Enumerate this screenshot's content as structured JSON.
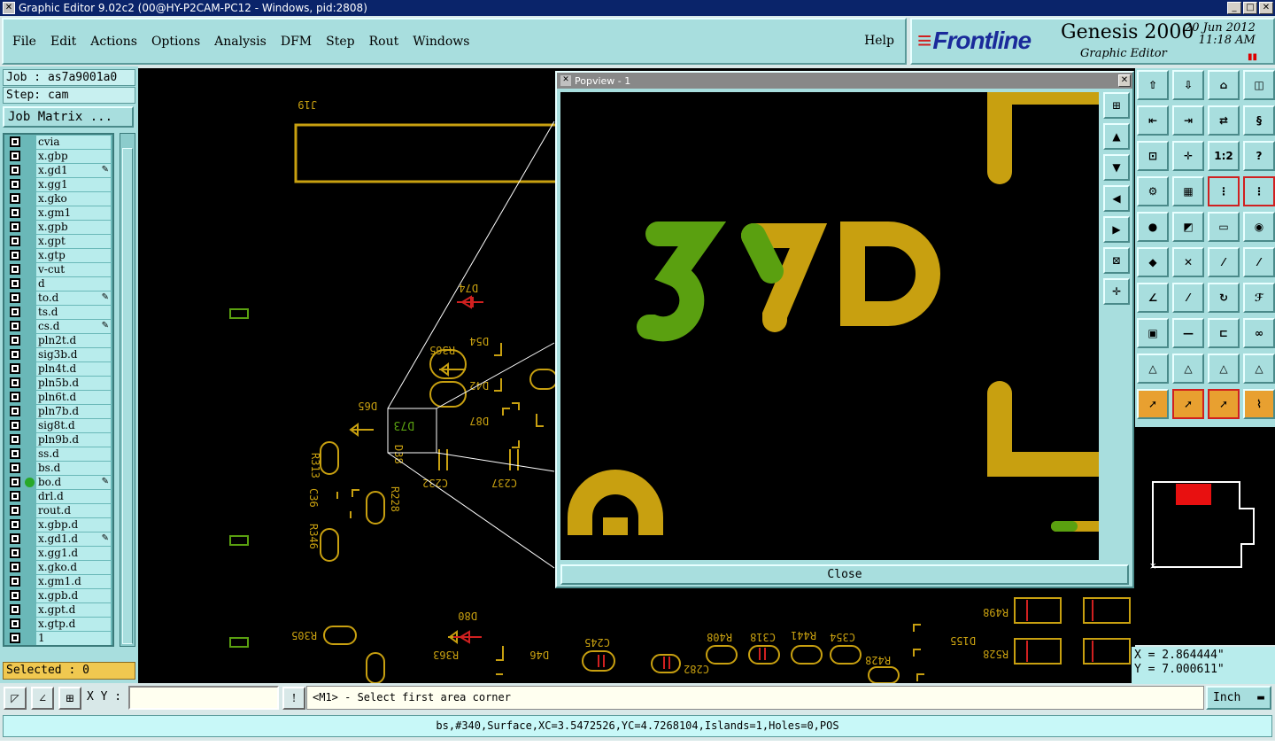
{
  "window": {
    "title": "Graphic Editor 9.02c2 (00@HY-P2CAM-PC12 - Windows, pid:2808)"
  },
  "menu": [
    "File",
    "Edit",
    "Actions",
    "Options",
    "Analysis",
    "DFM",
    "Step",
    "Rout",
    "Windows"
  ],
  "help_label": "Help",
  "brand": {
    "logo": "Frontline",
    "product": "Genesis 2000",
    "subtitle": "Graphic Editor",
    "date": "20 Jun 2012",
    "time": "11:18 AM"
  },
  "job": {
    "job_label": "Job : as7a9001a0",
    "step_label": "Step: cam",
    "matrix_button": "Job Matrix ..."
  },
  "layers": [
    {
      "name": "cvia"
    },
    {
      "name": "x.gbp"
    },
    {
      "name": "x.gd1",
      "mark": true
    },
    {
      "name": "x.gg1"
    },
    {
      "name": "x.gko"
    },
    {
      "name": "x.gm1"
    },
    {
      "name": "x.gpb"
    },
    {
      "name": "x.gpt"
    },
    {
      "name": "x.gtp"
    },
    {
      "name": "v-cut"
    },
    {
      "name": "d"
    },
    {
      "name": "to.d",
      "mark": true
    },
    {
      "name": "ts.d"
    },
    {
      "name": "cs.d",
      "mark": true
    },
    {
      "name": "pln2t.d"
    },
    {
      "name": "sig3b.d"
    },
    {
      "name": "pln4t.d"
    },
    {
      "name": "pln5b.d"
    },
    {
      "name": "pln6t.d"
    },
    {
      "name": "pln7b.d"
    },
    {
      "name": "sig8t.d"
    },
    {
      "name": "pln9b.d"
    },
    {
      "name": "ss.d"
    },
    {
      "name": "bs.d"
    },
    {
      "name": "bo.d",
      "mark": true,
      "active": true
    },
    {
      "name": "drl.d"
    },
    {
      "name": "rout.d"
    },
    {
      "name": "x.gbp.d"
    },
    {
      "name": "x.gd1.d",
      "mark": true
    },
    {
      "name": "x.gg1.d"
    },
    {
      "name": "x.gko.d"
    },
    {
      "name": "x.gm1.d"
    },
    {
      "name": "x.gpb.d"
    },
    {
      "name": "x.gpt.d"
    },
    {
      "name": "x.gtp.d"
    },
    {
      "name": "1"
    }
  ],
  "selected": "Selected : 0",
  "popview": {
    "title": "Popview - 1",
    "close_label": "Close",
    "pad_label": "D73"
  },
  "board_labels": {
    "j19": "J19",
    "d74": "D74",
    "r365": "R365",
    "d54": "D54",
    "d42": "D42",
    "d65": "D65",
    "d73": "D73",
    "d87": "D87",
    "c232": "C232",
    "c237": "C237",
    "r313": "R313",
    "d38": "D38",
    "r228": "R228",
    "c36": "C36",
    "r346": "R346",
    "d80": "D80",
    "r305": "R305",
    "r363": "R363",
    "d46": "D46",
    "c245": "C245",
    "c282": "C282",
    "r408": "R408",
    "c318": "C318",
    "r441": "R441",
    "c354": "C354",
    "r428": "R428",
    "d155": "D155",
    "r498": "R498",
    "r528": "R528"
  },
  "coords": {
    "x": "X = 2.864444\"",
    "y": "Y = 7.000611\""
  },
  "command": {
    "xy_label": "X Y :",
    "xy_value": "",
    "message": "<M1> - Select first area corner",
    "unit": "Inch"
  },
  "status": "bs,#340,Surface,XC=3.5472526,YC=4.7268104,Islands=1,Holes=0,POS",
  "colors": {
    "copper": "#c8a010",
    "highlight": "#5aa010",
    "background": "#000000",
    "panel": "#a8dede"
  }
}
